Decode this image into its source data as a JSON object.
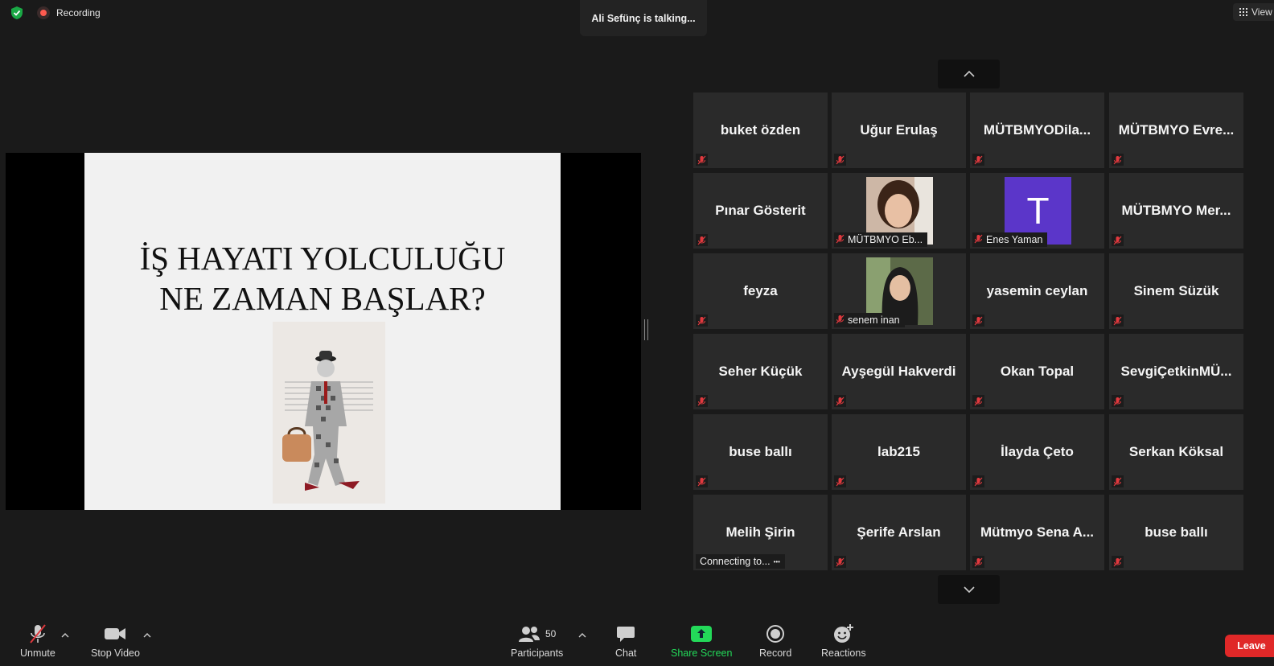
{
  "topbar": {
    "recording_label": "Recording",
    "talking_label": "Ali Sefünç is talking...",
    "view_label": "View"
  },
  "slide": {
    "title_line1": "İŞ HAYATI YOLCULUĞU",
    "title_line2": "NE ZAMAN BAŞLAR?"
  },
  "participants": [
    {
      "name": "buket özden"
    },
    {
      "name": "Uğur Erulaş"
    },
    {
      "name": "MÜTBMYODila..."
    },
    {
      "name": "MÜTBMYO  Evre..."
    },
    {
      "name": "Pınar Gösterit"
    },
    {
      "name": "MÜTBMYO Eb..."
    },
    {
      "name": "Enes Yaman",
      "avatar_letter": "T",
      "avatar_color": "#5b36c9"
    },
    {
      "name": "MÜTBMYO  Mer..."
    },
    {
      "name": "feyza"
    },
    {
      "name": "senem inan"
    },
    {
      "name": "yasemin ceylan"
    },
    {
      "name": "Sinem Süzük"
    },
    {
      "name": "Seher Küçük"
    },
    {
      "name": "Ayşegül Hakverdi"
    },
    {
      "name": "Okan Topal"
    },
    {
      "name": "SevgiÇetkinMÜ..."
    },
    {
      "name": "buse ballı"
    },
    {
      "name": "lab215"
    },
    {
      "name": "İlayda Çeto"
    },
    {
      "name": "Serkan Köksal"
    },
    {
      "name": "Melih Şirin",
      "status": "Connecting to..."
    },
    {
      "name": "Şerife Arslan"
    },
    {
      "name": "Mütmyo  Sena  A..."
    },
    {
      "name": "buse ballı"
    }
  ],
  "toolbar": {
    "unmute": "Unmute",
    "stop_video": "Stop Video",
    "participants": "Participants",
    "participants_count": "50",
    "chat": "Chat",
    "share_screen": "Share Screen",
    "record": "Record",
    "reactions": "Reactions",
    "leave": "Leave"
  },
  "colors": {
    "share_screen_green": "#23d959",
    "leave_red": "#e02828",
    "mic_muted_red": "#e0393e"
  }
}
